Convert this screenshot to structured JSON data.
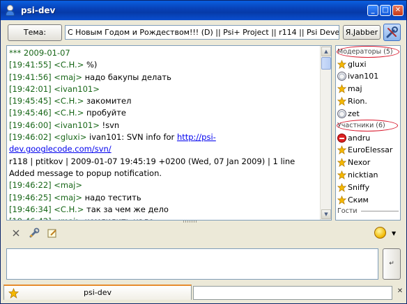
{
  "window": {
    "title": "psi-dev"
  },
  "topic": {
    "button_label": "Тема:",
    "text": "С Новым Годом и Рождеством!!! (D) || Psi+ Project || r114 || Psi Development · ",
    "account_label": "Я.Jabber"
  },
  "chat": {
    "lines": [
      {
        "ts": "*** 2009-01-07",
        "nick": "",
        "msg": ""
      },
      {
        "ts": "[19:41:55]",
        "nick": "<C.H.>",
        "msg": " %)"
      },
      {
        "ts": "[19:41:56]",
        "nick": "<maj>",
        "msg": " надо бакупы делать"
      },
      {
        "ts": "[19:42:01]",
        "nick": "<ivan101>",
        "msg": ""
      },
      {
        "ts": "[19:45:45]",
        "nick": "<C.H.>",
        "msg": " закомител"
      },
      {
        "ts": "[19:45:46]",
        "nick": "<C.H.>",
        "msg": " пробуйте"
      },
      {
        "ts": "[19:46:00]",
        "nick": "<ivan101>",
        "msg": " !svn"
      },
      {
        "ts": "[19:46:02]",
        "nick": "<gluxi>",
        "msg": " ivan101: SVN info for ",
        "link": "http://psi-"
      },
      {
        "ts": "",
        "nick": "",
        "msg": "",
        "link": "dev.googlecode.com/svn/"
      },
      {
        "ts": "",
        "nick": "",
        "msg": "r118 | ptitkov | 2009-01-07 19:45:19 +0200 (Wed, 07 Jan 2009) | 1 line"
      },
      {
        "ts": "",
        "nick": "",
        "msg": "Added message to popup notification."
      },
      {
        "ts": "[19:46:22]",
        "nick": "<maj>",
        "msg": ""
      },
      {
        "ts": "[19:46:25]",
        "nick": "<maj>",
        "msg": " надо тестить"
      },
      {
        "ts": "[19:46:34]",
        "nick": "<C.H.>",
        "msg": " так за чем же дело"
      },
      {
        "ts": "[19:46:42]",
        "nick": "<maj>",
        "msg": " комлилить надо"
      }
    ]
  },
  "userlist": {
    "moderators_header": "Модераторы (5)",
    "moderators": [
      {
        "name": "gluxi",
        "status": "online"
      },
      {
        "name": "ivan101",
        "status": "away"
      },
      {
        "name": "maj",
        "status": "online"
      },
      {
        "name": "Rion.",
        "status": "online"
      },
      {
        "name": "zet",
        "status": "away"
      }
    ],
    "participants_header": "Участники (6)",
    "participants": [
      {
        "name": "andru",
        "status": "dnd"
      },
      {
        "name": "EuroElessar",
        "status": "online"
      },
      {
        "name": "Nexor",
        "status": "online"
      },
      {
        "name": "nicktian",
        "status": "online"
      },
      {
        "name": "Sniffy",
        "status": "online"
      },
      {
        "name": "Ским",
        "status": "online"
      }
    ],
    "guests_header": "Гости"
  },
  "composer": {
    "text": "",
    "send_label": "↵"
  },
  "tabs": [
    {
      "label": "psi-dev",
      "active": true
    }
  ],
  "colors": {
    "titlebar": "#0842b8",
    "nick": "#176617",
    "link": "#0000ee",
    "oval": "#d8172b"
  },
  "icons": {
    "toolbar": [
      "clear-icon",
      "wrench-icon",
      "edit-icon"
    ],
    "emoticon": "smiley-icon"
  }
}
